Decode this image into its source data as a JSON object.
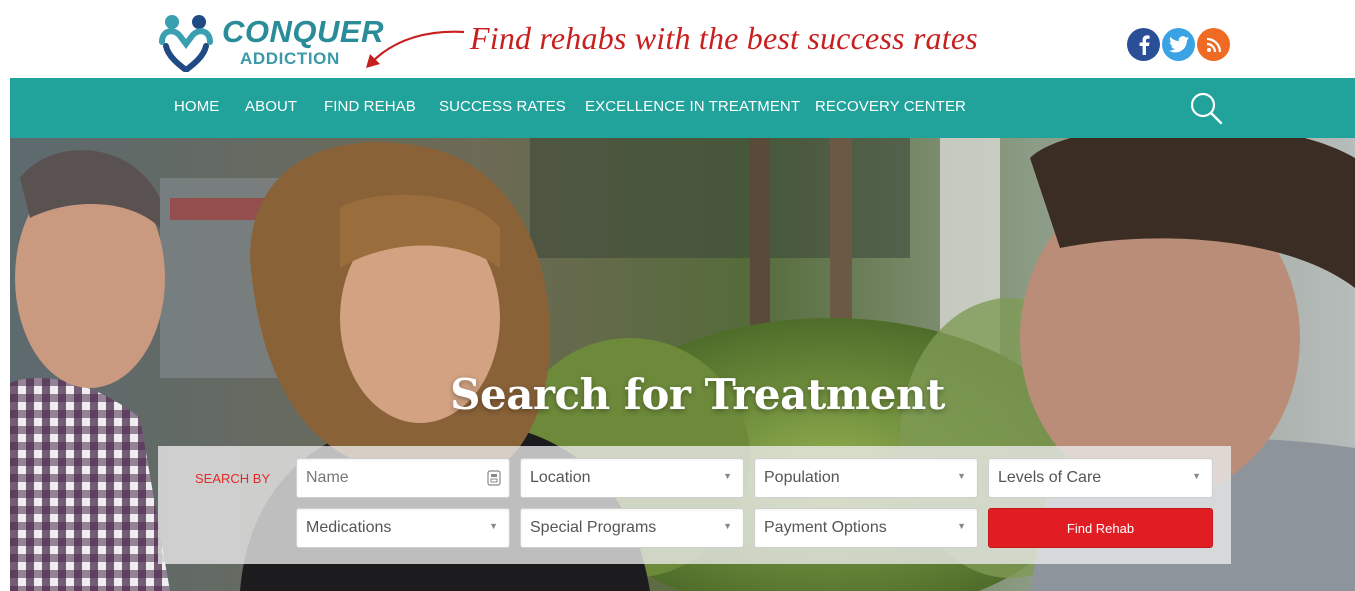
{
  "brand": {
    "logo_line1": "CONQUER",
    "logo_line2": "ADDICTION",
    "tagline": "Find rehabs with the best success rates",
    "teal": "#21a29b",
    "red": "#e11d24"
  },
  "social": [
    {
      "icon": "facebook-icon",
      "color": "#2b4f96"
    },
    {
      "icon": "twitter-icon",
      "color": "#3aa3e3"
    },
    {
      "icon": "rss-icon",
      "color": "#ef6a22"
    }
  ],
  "nav": {
    "items": [
      "HOME",
      "ABOUT",
      "FIND REHAB",
      "SUCCESS RATES",
      "EXCELLENCE IN TREATMENT",
      "RECOVERY CENTER"
    ],
    "search_icon": "search-icon"
  },
  "hero": {
    "title": "Search for Treatment"
  },
  "search": {
    "label": "SEARCH BY",
    "name_placeholder": "Name",
    "location": "Location",
    "population": "Population",
    "levels_of_care": "Levels of Care",
    "medications": "Medications",
    "special_programs": "Special Programs",
    "payment_options": "Payment Options",
    "submit_label": "Find Rehab"
  }
}
